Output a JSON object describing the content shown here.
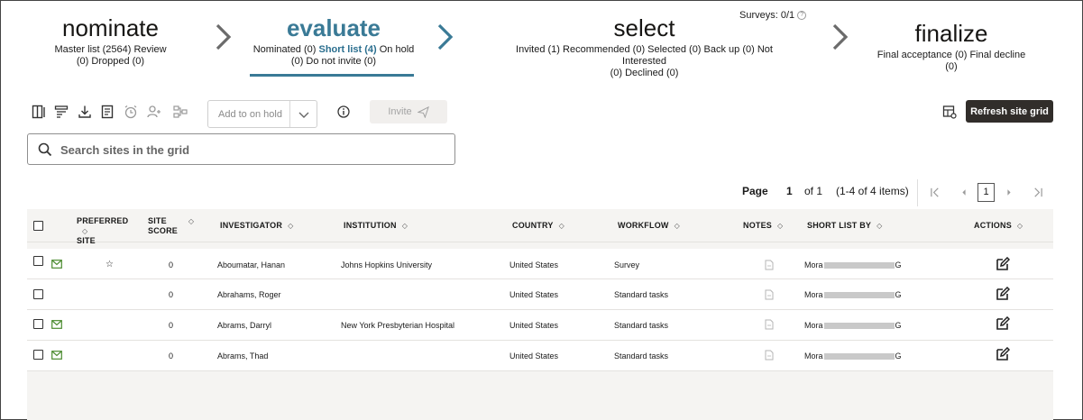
{
  "stages": {
    "nominate": {
      "title": "nominate",
      "line1": "Master list (2564)  Review",
      "line2": "(0)  Dropped (0)"
    },
    "evaluate": {
      "title": "evaluate",
      "nominated": "Nominated (0)",
      "shortlist": "Short list (4)",
      "onhold": "On hold",
      "line2": "(0)  Do not invite (0)"
    },
    "select": {
      "title": "select",
      "line1": "Invited (1)  Recommended (0)  Selected (0)  Back up (0)  Not Interested",
      "line2": "(0)  Declined (0)",
      "surveys": "Surveys: 0/1"
    },
    "finalize": {
      "title": "finalize",
      "line1": "Final acceptance (0)  Final decline (0)"
    }
  },
  "toolbar": {
    "hold_label": "Add to on hold",
    "invite_label": "Invite",
    "refresh_label": "Refresh site grid"
  },
  "search": {
    "placeholder": "Search sites in the grid"
  },
  "pagination": {
    "page_label": "Page",
    "page": "1",
    "of_label": "of 1",
    "range": "(1-4 of 4 items)",
    "current": "1"
  },
  "table": {
    "headers": {
      "preferred_1": "PREFERRED",
      "preferred_2": "SITE",
      "score_1": "SITE",
      "score_2": "SCORE",
      "investigator": "INVESTIGATOR",
      "institution": "INSTITUTION",
      "country": "COUNTRY",
      "workflow": "WORKFLOW",
      "notes": "NOTES",
      "shortlist_by": "SHORT LIST BY",
      "actions": "ACTIONS"
    },
    "rows": [
      {
        "preferred": "☆",
        "score": "0",
        "investigator": "Aboumatar, Hanan",
        "institution": "Johns Hopkins University",
        "country": "United States",
        "workflow": "Survey",
        "by_prefix": "Mora",
        "by_suffix": "G"
      },
      {
        "preferred": "",
        "score": "0",
        "investigator": "Abrahams, Roger",
        "institution": "",
        "country": "United States",
        "workflow": "Standard tasks",
        "by_prefix": "Mora",
        "by_suffix": "G"
      },
      {
        "preferred": "",
        "score": "0",
        "investigator": "Abrams, Darryl",
        "institution": "New York Presbyterian Hospital",
        "country": "United States",
        "workflow": "Standard tasks",
        "by_prefix": "Mora",
        "by_suffix": "G"
      },
      {
        "preferred": "",
        "score": "0",
        "investigator": "Abrams, Thad",
        "institution": "",
        "country": "United States",
        "workflow": "Standard tasks",
        "by_prefix": "Mora",
        "by_suffix": "G"
      }
    ]
  },
  "colors": {
    "accent": "#3a7a96",
    "primary_button": "#312d2a",
    "mail_icon": "#4b8b2f"
  }
}
